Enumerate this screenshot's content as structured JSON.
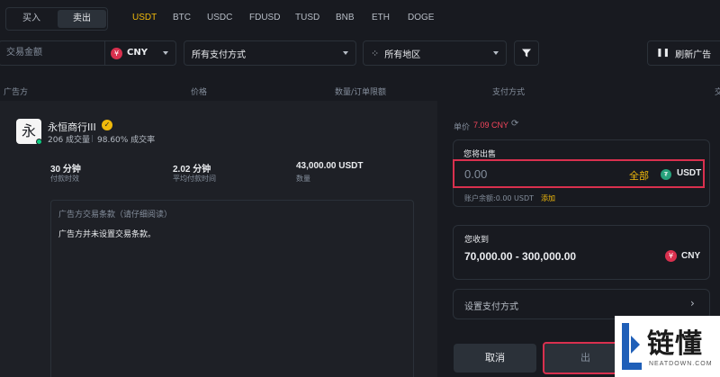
{
  "side_toggle": {
    "buy": "买入",
    "sell": "卖出"
  },
  "coins": [
    "USDT",
    "BTC",
    "USDC",
    "FDUSD",
    "TUSD",
    "BNB",
    "ETH",
    "DOGE"
  ],
  "filters": {
    "amount_placeholder": "交易金额",
    "currency": "CNY",
    "payment": "所有支付方式",
    "region": "所有地区",
    "refresh": "刷新广告"
  },
  "columns": {
    "advertiser": "广告方",
    "price": "价格",
    "limit": "数量/订单限额",
    "payment": "支付方式",
    "trade": "交"
  },
  "advertiser": {
    "avatar_char": "永",
    "name": "永恒商行III",
    "trades": "206 成交量",
    "completion": "98.60% 成交率",
    "stats": [
      {
        "value": "30 分钟",
        "label": "付款时效"
      },
      {
        "value": "2.02 分钟",
        "label": "平均付款时间"
      },
      {
        "value": "43,000.00 USDT",
        "label": "数量"
      }
    ],
    "terms_title": "广告方交易条款（请仔细阅读）",
    "terms_body": "广告方并未设置交易条款。"
  },
  "order": {
    "price_label": "单价",
    "price_value": "7.09 CNY",
    "sell_label": "您将出售",
    "sell_value": "0.00",
    "all_label": "全部",
    "sell_asset": "USDT",
    "balance": "账户余额:0.00 USDT",
    "add_label": "添加",
    "receive_label": "您收到",
    "receive_value": "70,000.00 - 300,000.00",
    "receive_asset": "CNY",
    "payment_label": "设置支付方式",
    "cancel": "取消",
    "confirm": "出"
  },
  "watermark": {
    "text": "链懂",
    "sub": "NEATDOWN.COM"
  },
  "colors": {
    "accent": "#f0b90b",
    "price": "#f6465d",
    "highlight": "#d9304e",
    "bg": "#181a20",
    "card": "#1e2026"
  }
}
